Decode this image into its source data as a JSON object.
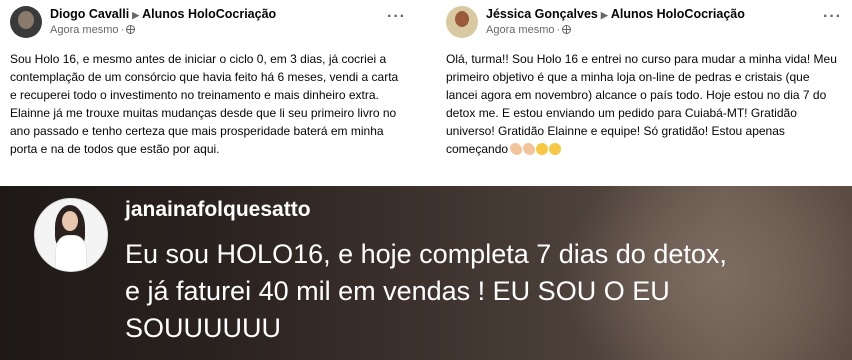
{
  "posts": [
    {
      "author": "Diogo Cavalli",
      "group": "Alunos HoloCocriação",
      "time": "Agora mesmo",
      "more_label": "···",
      "body": "Sou Holo 16, e mesmo antes de iniciar o ciclo 0, em 3 dias, já cocriei a contemplação de um consórcio que havia feito há 6 meses, vendi a carta e recuperei todo o investimento no treinamento e mais dinheiro extra. Elainne já me trouxe muitas mudanças desde  que li seu primeiro livro  no ano passado e tenho certeza que mais prosperidade baterá em minha porta e na de todos que estão por aqui."
    },
    {
      "author": "Jéssica Gonçalves",
      "group": "Alunos HoloCocriação",
      "time": "Agora mesmo",
      "more_label": "···",
      "body": "Olá, turma!! Sou Holo 16 e entrei no curso para mudar a minha vida! Meu primeiro objetivo é que a minha loja on-line de pedras e cristais (que lancei agora em novembro) alcance o país todo. Hoje estou no dia 7 do detox me. E estou enviando um pedido para Cuiabá-MT! Gratidão universo! Gratidão Elainne e equipe! Só gratidão! Estou apenas começando",
      "emojis": [
        "flexed-arm",
        "flexed-arm",
        "grinning-sweat-face",
        "grinning-sweat-face"
      ]
    }
  ],
  "story": {
    "username": "janainafolquesatto",
    "message": "Eu sou HOLO16, e hoje completa 7 dias do detox, e já faturei 40 mil em vendas ! EU SOU O EU SOUUUUUU"
  },
  "icons": {
    "separator": "caret-right-icon",
    "privacy": "globe-icon"
  }
}
